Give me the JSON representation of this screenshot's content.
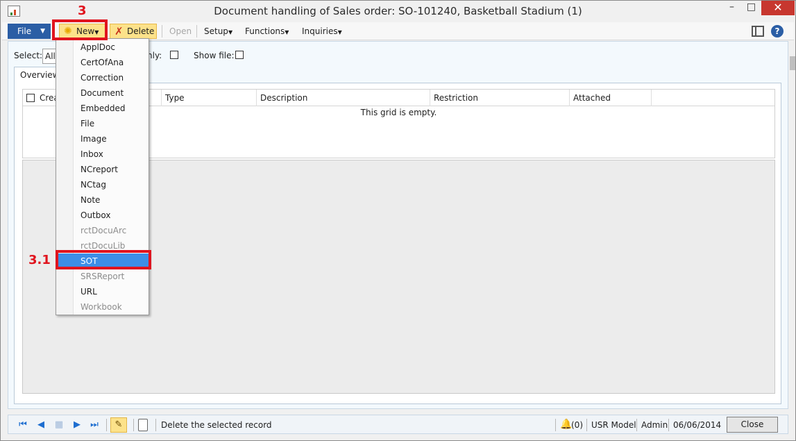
{
  "window": {
    "title": "Document handling of Sales order: SO-101240, Basketball Stadium (1)",
    "minimize_glyph": "–",
    "maximize_glyph": "□",
    "close_glyph": "✕"
  },
  "action_pane": {
    "file_label": "File",
    "new_label": "New",
    "delete_label": "Delete",
    "open_label": "Open",
    "setup_label": "Setup",
    "functions_label": "Functions",
    "inquiries_label": "Inquiries",
    "caret": "▼"
  },
  "filters": {
    "select_label": "Select:",
    "select_value": "All",
    "only_label": "nly:",
    "show_file_label": "Show file:"
  },
  "tabs": {
    "overview_label": "Overview"
  },
  "grid": {
    "columns": [
      "Crea",
      "Type",
      "Description",
      "Restriction",
      "Attached"
    ],
    "empty_text": "This grid is empty."
  },
  "new_menu": {
    "items": [
      {
        "label": "ApplDoc",
        "state": "enabled"
      },
      {
        "label": "CertOfAna",
        "state": "enabled"
      },
      {
        "label": "Correction",
        "state": "enabled"
      },
      {
        "label": "Document",
        "state": "enabled"
      },
      {
        "label": "Embedded",
        "state": "enabled"
      },
      {
        "label": "File",
        "state": "enabled"
      },
      {
        "label": "Image",
        "state": "enabled"
      },
      {
        "label": "Inbox",
        "state": "enabled"
      },
      {
        "label": "NCreport",
        "state": "enabled"
      },
      {
        "label": "NCtag",
        "state": "enabled"
      },
      {
        "label": "Note",
        "state": "enabled"
      },
      {
        "label": "Outbox",
        "state": "enabled"
      },
      {
        "label": "rctDocuArc",
        "state": "disabled"
      },
      {
        "label": "rctDocuLib",
        "state": "disabled"
      },
      {
        "label": "SOT",
        "state": "selected"
      },
      {
        "label": "SRSReport",
        "state": "disabled"
      },
      {
        "label": "URL",
        "state": "enabled"
      },
      {
        "label": "Workbook",
        "state": "disabled"
      }
    ]
  },
  "status_bar": {
    "status_text": "Delete the selected record",
    "notification_count": "(0)",
    "company": "USR Model",
    "user": "Admin",
    "date": "06/06/2014",
    "close_label": "Close"
  },
  "annotations": {
    "step_new": "3",
    "step_sot": "3.1",
    "highlight_color": "#e0141e"
  },
  "colors": {
    "accent": "#2b5ea5",
    "menu_selected": "#3d8ee6",
    "button_highlight": "#fce28a"
  }
}
